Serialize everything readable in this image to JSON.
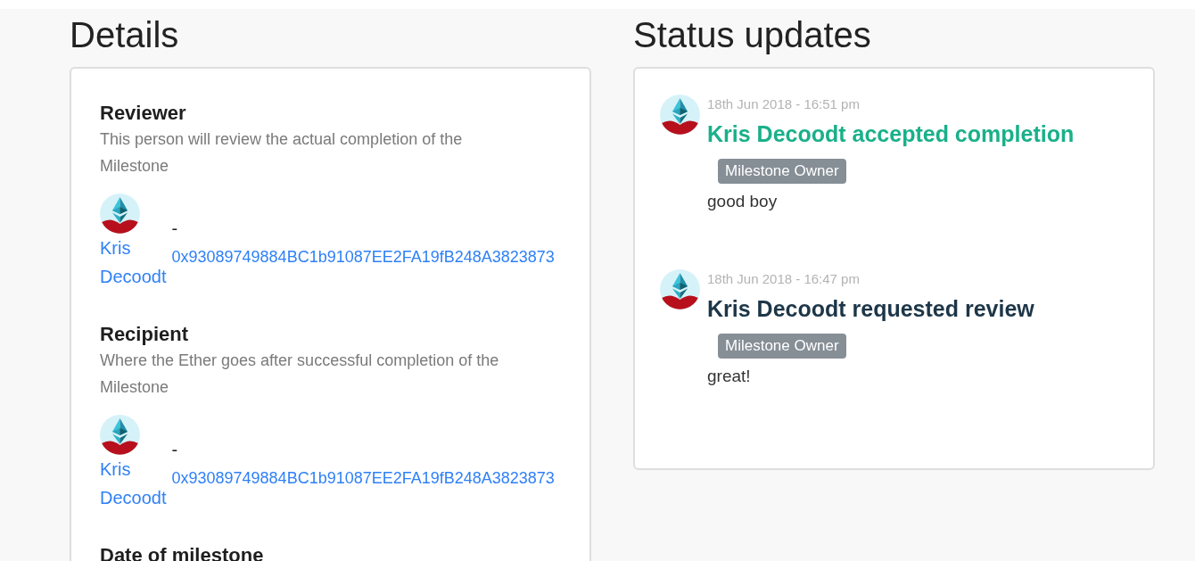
{
  "details": {
    "heading": "Details",
    "sections": [
      {
        "title": "Reviewer",
        "description": "This person will review the actual completion of the Milestone",
        "person": {
          "name": "Kris Decoodt",
          "separator": "-",
          "address": "0x93089749884BC1b91087EE2FA19fB248A3823873"
        }
      },
      {
        "title": "Recipient",
        "description": "Where the Ether goes after successful completion of the Milestone",
        "person": {
          "name": "Kris Decoodt",
          "separator": "-",
          "address": "0x93089749884BC1b91087EE2FA19fB248A3823873"
        }
      },
      {
        "title": "Date of milestone"
      }
    ]
  },
  "status_updates": {
    "heading": "Status updates",
    "items": [
      {
        "time": "18th Jun 2018 - 16:51 pm",
        "title": "Kris Decoodt accepted completion",
        "color": "#19b08a",
        "badge": "Milestone Owner",
        "message": "good boy"
      },
      {
        "time": "18th Jun 2018 - 16:47 pm",
        "title": "Kris Decoodt requested review",
        "color": "#1d3648",
        "badge": "Milestone Owner",
        "message": "great!"
      }
    ]
  }
}
